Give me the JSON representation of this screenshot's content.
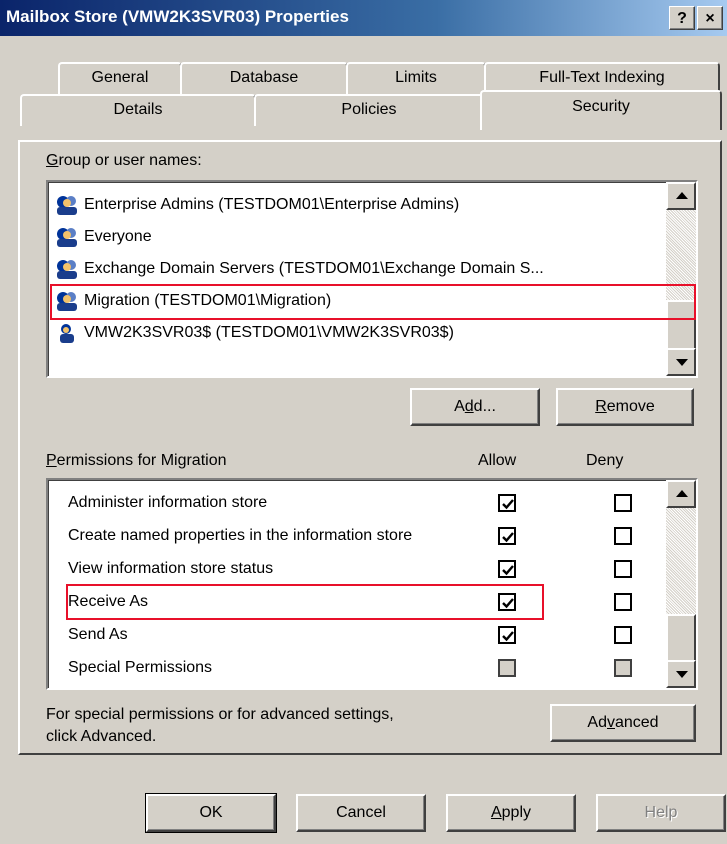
{
  "window": {
    "title": "Mailbox Store (VMW2K3SVR03) Properties",
    "help_button": "?",
    "close_button": "×"
  },
  "tabs": {
    "row1": [
      "General",
      "Database",
      "Limits",
      "Full-Text Indexing"
    ],
    "row2": [
      "Details",
      "Policies",
      "Security"
    ],
    "selected": "Security"
  },
  "groups": {
    "label": "Group or user names:",
    "items": [
      "Enterprise Admins (TESTDOM01\\Enterprise Admins)",
      "Everyone",
      "Exchange Domain Servers (TESTDOM01\\Exchange Domain S...",
      "Migration (TESTDOM01\\Migration)",
      "VMW2K3SVR03$ (TESTDOM01\\VMW2K3SVR03$)"
    ],
    "add_button": "Add...",
    "remove_button": "Remove"
  },
  "permissions": {
    "label": "Permissions for Migration",
    "allow_header": "Allow",
    "deny_header": "Deny",
    "rows": [
      {
        "name": "Administer information store",
        "allow": true,
        "deny": false
      },
      {
        "name": "Create named properties in the information store",
        "allow": true,
        "deny": false
      },
      {
        "name": "View information store status",
        "allow": true,
        "deny": false
      },
      {
        "name": "Receive As",
        "allow": true,
        "deny": false
      },
      {
        "name": "Send As",
        "allow": true,
        "deny": false
      },
      {
        "name": "Special Permissions",
        "allow": false,
        "deny": false
      }
    ]
  },
  "advanced": {
    "text_line1": "For special permissions or for advanced settings,",
    "text_line2": "click Advanced.",
    "button": "Advanced"
  },
  "footer": {
    "ok": "OK",
    "cancel": "Cancel",
    "apply": "Apply",
    "help": "Help"
  },
  "colors": {
    "highlight_box": "#e8102a",
    "titlebar_start": "#0a246a",
    "face": "#d4d0c8"
  }
}
